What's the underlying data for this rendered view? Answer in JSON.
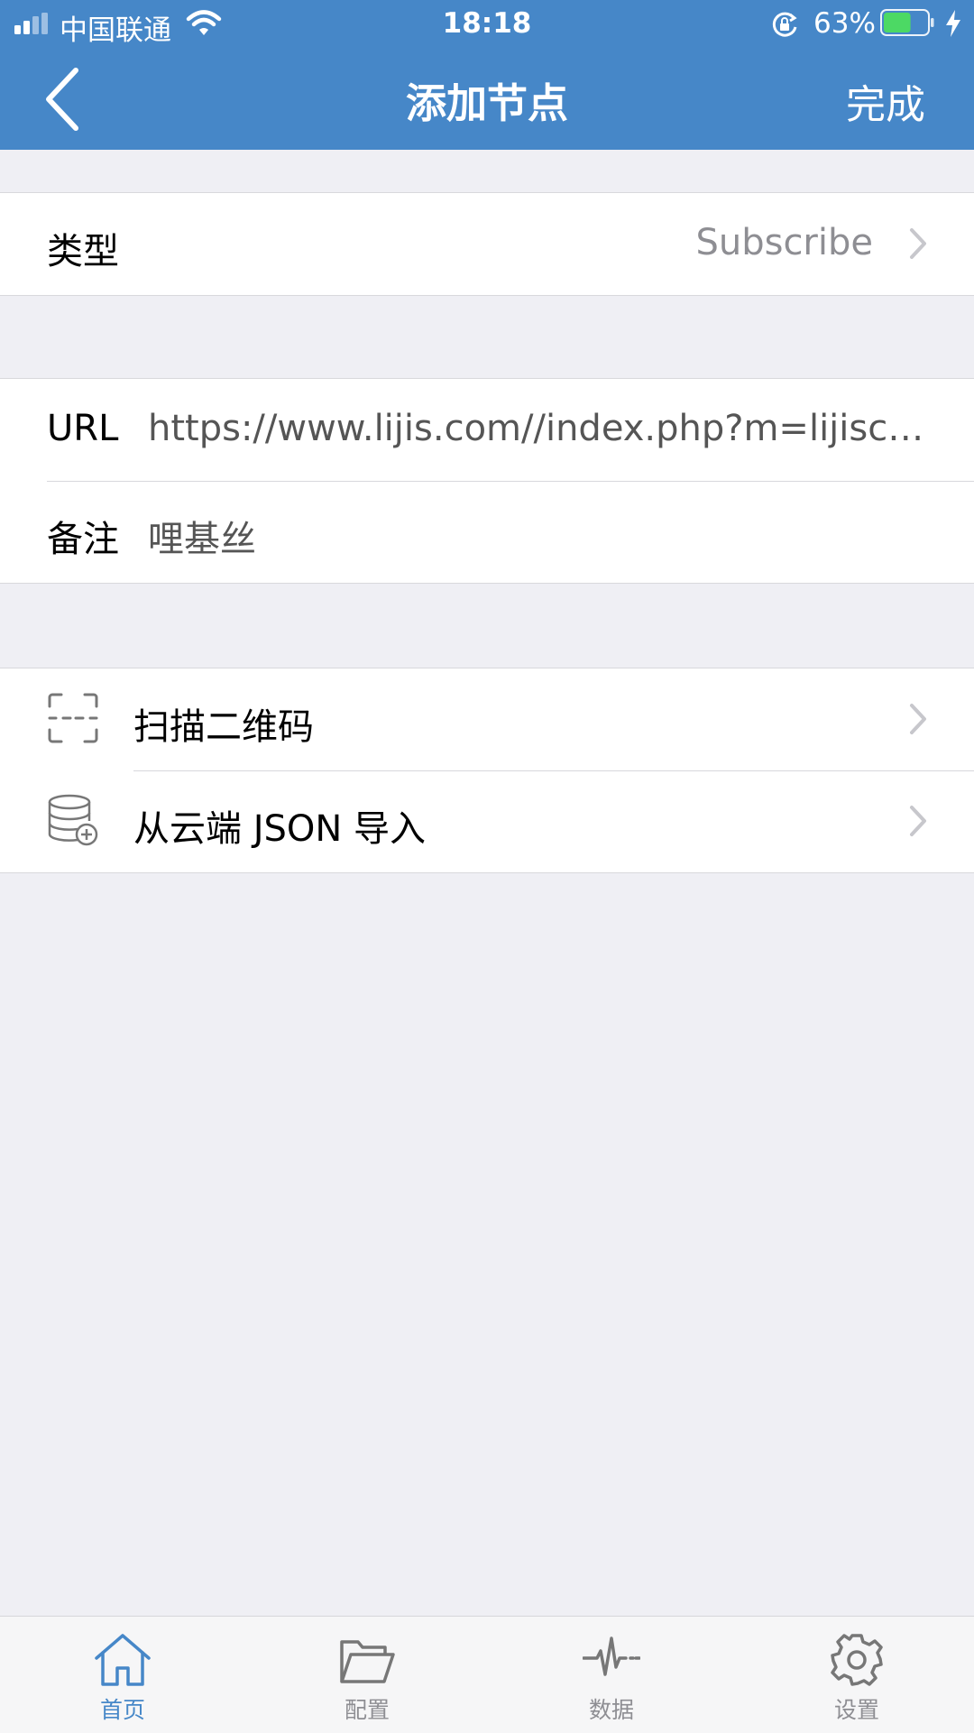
{
  "status_bar": {
    "carrier": "中国联通",
    "time": "18:18",
    "battery_percent": "63%",
    "battery_level": 0.63
  },
  "nav": {
    "title": "添加节点",
    "done_label": "完成"
  },
  "type_row": {
    "label": "类型",
    "value": "Subscribe"
  },
  "fields": {
    "url_label": "URL",
    "url_value": "https://www.lijis.com//index.php?m=lijisclou...",
    "remark_label": "备注",
    "remark_value": "哩基丝"
  },
  "actions": {
    "scan_label": "扫描二维码",
    "import_label": "从云端 JSON 导入"
  },
  "tabs": [
    {
      "label": "首页",
      "icon": "home-icon",
      "active": true
    },
    {
      "label": "配置",
      "icon": "folder-icon",
      "active": false
    },
    {
      "label": "数据",
      "icon": "pulse-icon",
      "active": false
    },
    {
      "label": "设置",
      "icon": "gear-icon",
      "active": false
    }
  ],
  "colors": {
    "accent": "#4687c8",
    "background": "#efeff4",
    "battery_fill": "#4cd964"
  }
}
